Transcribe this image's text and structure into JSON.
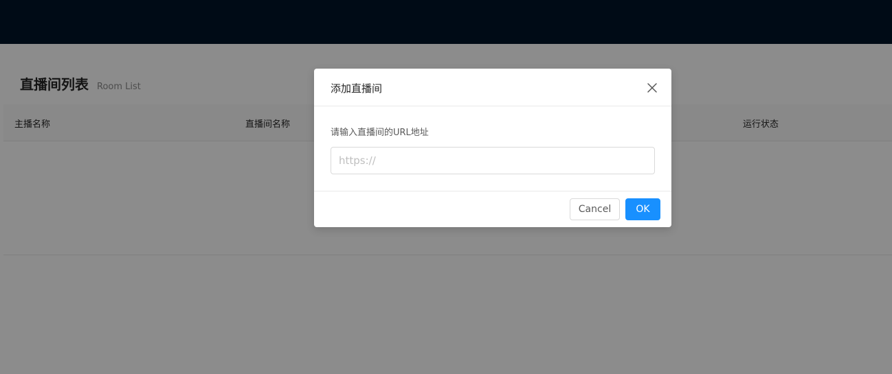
{
  "page": {
    "title": "直播间列表",
    "subtitle": "Room List"
  },
  "table": {
    "columns": [
      "主播名称",
      "直播间名称",
      "运行状态"
    ]
  },
  "modal": {
    "title": "添加直播间",
    "label": "请输入直播间的URL地址",
    "input_value": "",
    "input_placeholder": "https://",
    "cancel_label": "Cancel",
    "ok_label": "OK"
  },
  "colors": {
    "topbar": "#001529",
    "primary": "#1890ff",
    "mask": "rgba(0,0,0,0.45)"
  },
  "icons": {
    "close": "close-icon"
  }
}
